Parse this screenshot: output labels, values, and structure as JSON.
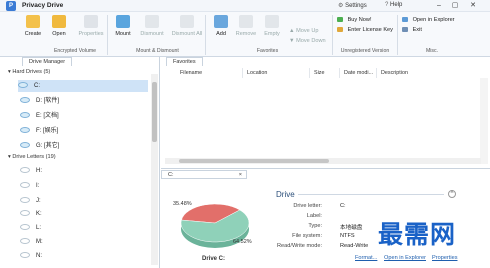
{
  "app": {
    "logo": "P",
    "title": "Privacy Drive",
    "settings": "Settings",
    "help": "Help"
  },
  "window_controls": {
    "min": "–",
    "max": "▢",
    "close": "✕"
  },
  "ribbon": {
    "encrypted_volume": {
      "group_label": "Encrypted Volume",
      "create": "Create",
      "open": "Open",
      "properties": "Properties"
    },
    "mount_dismount": {
      "group_label": "Mount & Dismount",
      "mount": "Mount",
      "dismount": "Dismount",
      "dismount_all": "Dismount All"
    },
    "favorites": {
      "group_label": "Favorites",
      "add": "Add",
      "remove": "Remove",
      "empty": "Empty",
      "move_up": "Move Up",
      "move_down": "Move Down"
    },
    "unregistered": {
      "group_label": "Unregistered Version",
      "buy_now": "Buy Now!",
      "enter_key": "Enter License Key"
    },
    "misc": {
      "group_label": "Misc.",
      "open_explorer": "Open in Explorer",
      "exit": "Exit"
    }
  },
  "left": {
    "tab": "Drive Manager",
    "hard_drives_header": "Hard Drives (5)",
    "hard_drives": [
      "C:",
      "D: [软件]",
      "E: [文档]",
      "F: [娱乐]",
      "G: [其它]"
    ],
    "drive_letters_header": "Drive Letters (19)",
    "drive_letters": [
      "H:",
      "I:",
      "J:",
      "K:",
      "L:",
      "M:",
      "N:"
    ]
  },
  "favorites": {
    "tab": "Favorites",
    "columns": [
      "Filename",
      "Location",
      "Size",
      "Date modi...",
      "Description"
    ]
  },
  "detail": {
    "tab": "C:",
    "tab_close": "×",
    "heading": "Drive",
    "rows": [
      {
        "label": "Drive letter:",
        "value": "C:"
      },
      {
        "label": "Label:",
        "value": ""
      },
      {
        "label": "Type:",
        "value": "本地磁盘"
      },
      {
        "label": "File system:",
        "value": "NTFS"
      },
      {
        "label": "Read/Write mode:",
        "value": "Read-Write"
      }
    ],
    "links": [
      "Format...",
      "Open in Explorer",
      "Properties"
    ],
    "pie_used_label": "35.48%",
    "pie_free_label": "64.52%",
    "pie_caption": "Drive C:",
    "used_color": "#e26f6a",
    "free_color": "#8fd1b9"
  },
  "chart_data": {
    "type": "pie",
    "categories": [
      "Used",
      "Free"
    ],
    "values": [
      35.48,
      64.52
    ],
    "title": "Drive C:"
  },
  "watermark": "最需网"
}
